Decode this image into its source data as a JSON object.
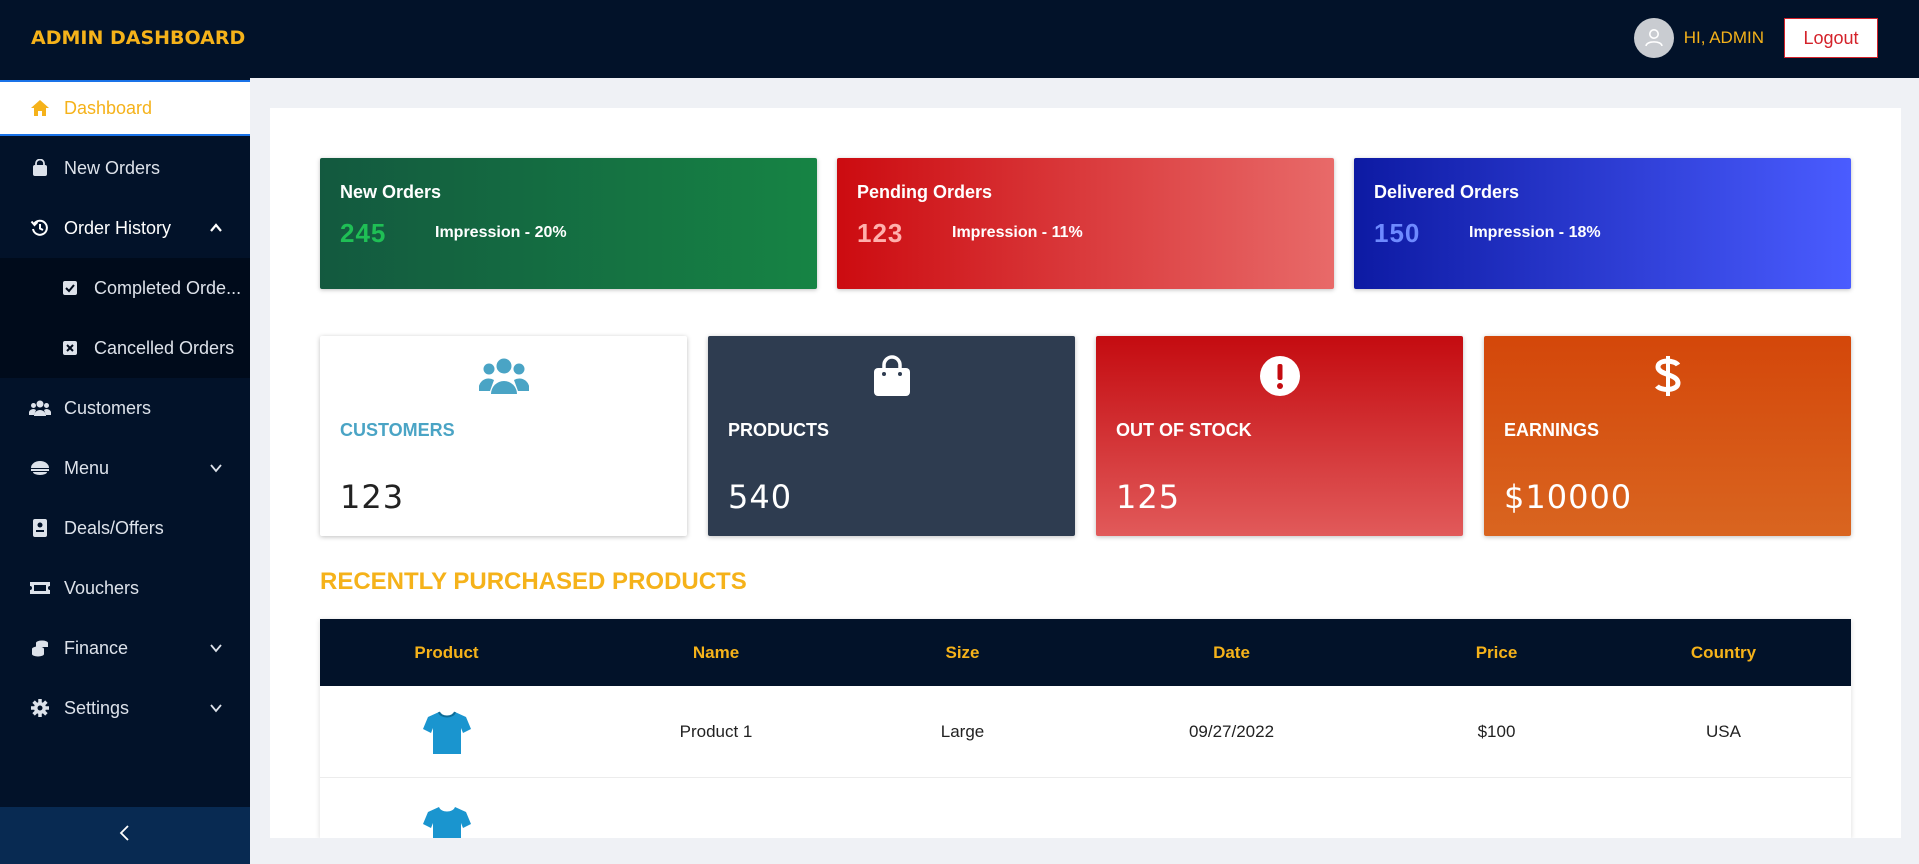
{
  "header": {
    "brand": "ADMIN DASHBOARD",
    "greeting": "HI, ADMIN",
    "logout_label": "Logout",
    "avatar_icon": "user-avatar-icon"
  },
  "sidebar": {
    "items": [
      {
        "label": "Dashboard",
        "icon": "home-icon",
        "active": true
      },
      {
        "label": "New Orders",
        "icon": "shopping-bag-icon"
      },
      {
        "label": "Order History",
        "icon": "history-icon",
        "expanded": true
      },
      {
        "label": "Completed Orde...",
        "icon": "check-square-icon"
      },
      {
        "label": "Cancelled Orders",
        "icon": "x-square-icon"
      },
      {
        "label": "Customers",
        "icon": "users-icon"
      },
      {
        "label": "Menu",
        "icon": "menu-bowl-icon"
      },
      {
        "label": "Deals/Offers",
        "icon": "deals-icon"
      },
      {
        "label": "Vouchers",
        "icon": "ticket-icon"
      },
      {
        "label": "Finance",
        "icon": "coins-icon"
      },
      {
        "label": "Settings",
        "icon": "gear-icon"
      }
    ],
    "collapse_icon": "chevron-left-icon"
  },
  "orders": [
    {
      "title": "New Orders",
      "count": "245",
      "impression": "Impression - 20%"
    },
    {
      "title": "Pending Orders",
      "count": "123",
      "impression": "Impression - 11%"
    },
    {
      "title": "Delivered Orders",
      "count": "150",
      "impression": "Impression - 18%"
    }
  ],
  "stats": [
    {
      "label": "CUSTOMERS",
      "value": "123",
      "icon": "users-icon"
    },
    {
      "label": "PRODUCTS",
      "value": "540",
      "icon": "shopping-bag-icon"
    },
    {
      "label": "OUT OF STOCK",
      "value": "125",
      "icon": "alert-icon"
    },
    {
      "label": "EARNINGS",
      "value": "$10000",
      "icon": "dollar-icon"
    }
  ],
  "recent": {
    "title": "RECENTLY PURCHASED PRODUCTS",
    "columns": [
      "Product",
      "Name",
      "Size",
      "Date",
      "Price",
      "Country"
    ],
    "rows": [
      {
        "name": "Product 1",
        "size": "Large",
        "date": "09/27/2022",
        "price": "$100",
        "country": "USA",
        "image": "tshirt-icon"
      },
      {
        "name": "",
        "size": "",
        "date": "",
        "price": "",
        "country": "",
        "image": "tshirt-icon"
      }
    ]
  },
  "colors": {
    "accent": "#f5b21a",
    "navy": "#021229",
    "logout": "#d4222a"
  }
}
